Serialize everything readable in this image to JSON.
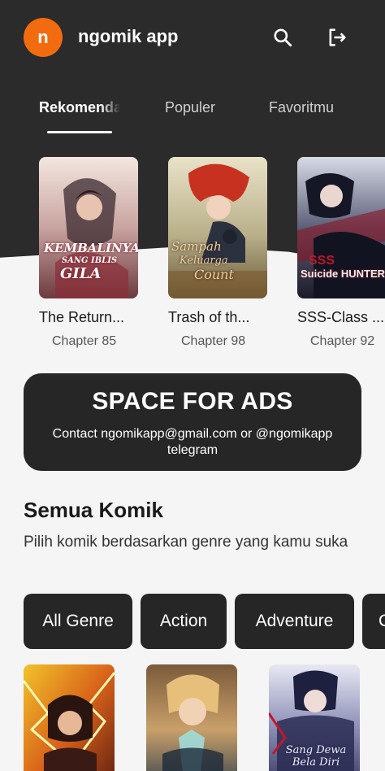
{
  "app": {
    "avatar_letter": "n",
    "title": "ngomik app"
  },
  "tabs": [
    {
      "label": "Rekomendasi",
      "active": true
    },
    {
      "label": "Populer",
      "active": false
    },
    {
      "label": "Favoritmu",
      "active": false
    }
  ],
  "recommendations": [
    {
      "title": "The Return...",
      "chapter": "Chapter 85",
      "cover_text": [
        "KEMBALINYA",
        "SANG IBLIS",
        "GILA"
      ]
    },
    {
      "title": "Trash of th...",
      "chapter": "Chapter 98",
      "cover_text": [
        "Sampah",
        "Keluarga",
        "Count"
      ]
    },
    {
      "title": "SSS-Class ...",
      "chapter": "Chapter 92",
      "cover_text": [
        "SSS",
        "Suicide HUNTER"
      ]
    }
  ],
  "ads": {
    "title": "SPACE FOR ADS",
    "description": "Contact ngomikapp@gmail.com or @ngomikapp telegram"
  },
  "all_comics": {
    "title": "Semua Komik",
    "subtitle": "Pilih komik berdasarkan genre yang kamu suka"
  },
  "genres": [
    "All Genre",
    "Action",
    "Adventure",
    "C"
  ],
  "comics": [
    {
      "cover_text": ""
    },
    {
      "cover_text": ""
    },
    {
      "cover_text": "Sang Dewa Bela Diri"
    }
  ],
  "colors": {
    "header_bg": "#2b2b2b",
    "accent": "#f26b0f",
    "chip_bg": "#262626",
    "page_bg": "#f5f5f5"
  }
}
